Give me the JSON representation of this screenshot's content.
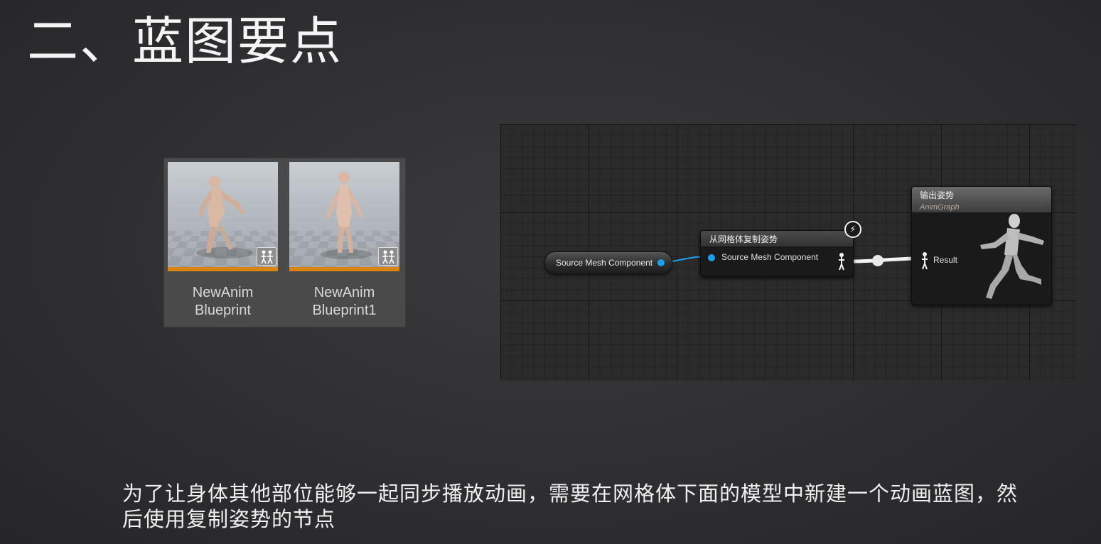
{
  "slide": {
    "title": "二、蓝图要点",
    "caption": "为了让身体其他部位能够一起同步播放动画，需要在网格体下面的模型中新建一个动画蓝图，然后使用复制姿势的节点"
  },
  "assets": [
    {
      "line1": "NewAnim",
      "line2": "Blueprint",
      "icon": "anim-blueprint-icon"
    },
    {
      "line1": "NewAnim",
      "line2": "Blueprint1",
      "icon": "anim-blueprint-icon"
    }
  ],
  "graph": {
    "variable_node": {
      "label": "Source Mesh Component"
    },
    "copy_pose_node": {
      "title": "从网格体复制姿势",
      "pin_label": "Source Mesh Component"
    },
    "output_node": {
      "title": "输出姿势",
      "subtitle": "AnimGraph",
      "pin_label": "Result"
    },
    "colors": {
      "object_pin": "#1aa0ee",
      "asset_bar": "#d98414"
    }
  }
}
